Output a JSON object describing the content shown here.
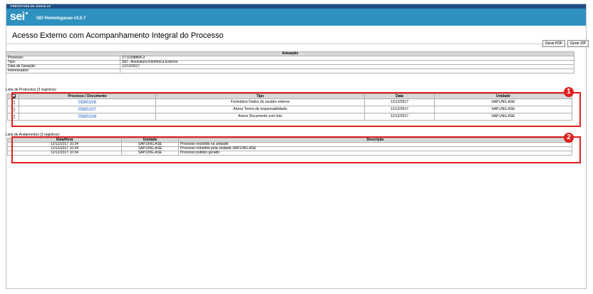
{
  "topbar": {
    "org": "PREFEITURA DE JOINVILLE"
  },
  "header": {
    "logo": "sei",
    "system": "SEI Homologacao v3.0.7"
  },
  "page": {
    "title": "Acesso Externo com Acompanhamento Integral do Processo"
  },
  "buttons": {
    "pdf": "Gerar PDF",
    "zip": "Gerar ZIP"
  },
  "autuacao": {
    "header": "Autuação",
    "rows": [
      {
        "label": "Processo:",
        "value": "17.0.008864-2"
      },
      {
        "label": "Tipo:",
        "value": "SEI - Assinatura Eletrônica Externa"
      },
      {
        "label": "Data de Geração:",
        "value": "12/12/2017"
      },
      {
        "label": "Interessados:",
        "value": ""
      }
    ]
  },
  "protocolos": {
    "label": "Lista de Protocolos (3 registros):",
    "headers": [
      "Processo / Documento",
      "Tipo",
      "Data",
      "Unidade"
    ],
    "rows": [
      {
        "doc": "0580106",
        "tipo": "Formulário Dados do usuário externo",
        "data": "12/12/2017",
        "unidade": "SAP.UNG.ASE"
      },
      {
        "doc": "0580107",
        "tipo": "Anexo Termo de responsabilidade",
        "data": "12/12/2017",
        "unidade": "SAP.UNG.ASE"
      },
      {
        "doc": "0580108",
        "tipo": "Anexo Documento com foto",
        "data": "12/12/2017",
        "unidade": "SAP.UNG.ASE"
      }
    ]
  },
  "andamentos": {
    "label": "Lista de Andamentos (3 registros):",
    "headers": [
      "Data/Hora",
      "Unidade",
      "Descrição"
    ],
    "rows": [
      {
        "datahora": "12/12/2017 10:34",
        "unidade": "SAP.UNG.ASE",
        "descricao": "Processo recebido na unidade"
      },
      {
        "datahora": "12/12/2017 10:34",
        "unidade": "SAP.UNG.ASE",
        "descricao": "Processo remetido pela unidade SAP.UNG.ASE"
      },
      {
        "datahora": "12/12/2017 10:34",
        "unidade": "SAP.UNG.ASE",
        "descricao": "Processo público gerado"
      }
    ]
  },
  "annotations": {
    "badge1": "1",
    "badge2": "2"
  },
  "colors": {
    "header": "#2f91bf",
    "topbar": "#1f4e82",
    "highlight": "#e02020",
    "link": "#1d5fbf"
  }
}
